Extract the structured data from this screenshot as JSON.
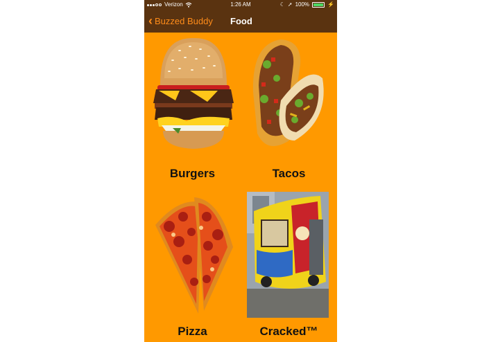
{
  "status_bar": {
    "carrier": "Verizon",
    "time": "1:26 AM",
    "battery": "100%",
    "signal_bars_filled": 3,
    "signal_bars_total": 5
  },
  "nav": {
    "back_label": "Buzzed Buddy",
    "title": "Food"
  },
  "colors": {
    "background": "#FF9900",
    "navbar": "#5a3310",
    "back_tint": "#ff8c1a"
  },
  "items": [
    {
      "label": "Burgers",
      "icon": "burger-icon"
    },
    {
      "label": "Tacos",
      "icon": "taco-icon"
    },
    {
      "label": "Pizza",
      "icon": "pizza-icon"
    },
    {
      "label": "Cracked™",
      "icon": "food-truck-icon"
    }
  ]
}
